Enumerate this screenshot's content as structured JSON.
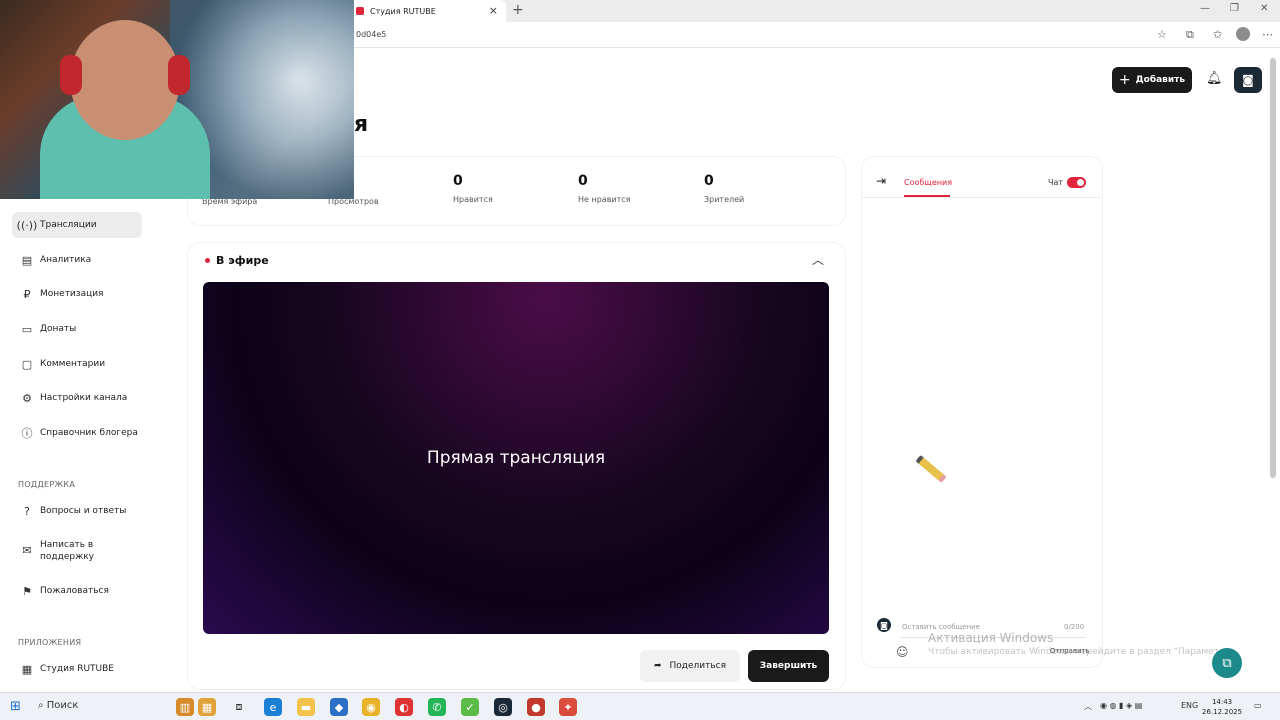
{
  "browser": {
    "tab_title": "Студия RUTUBE",
    "url_fragment": "0d04e5"
  },
  "header": {
    "add_label": "Добавить",
    "page_title_fragment": "я"
  },
  "sidebar": {
    "items": [
      {
        "label": "Трансляции",
        "icon": "broadcast-icon",
        "active": true
      },
      {
        "label": "Аналитика",
        "icon": "chart-icon"
      },
      {
        "label": "Монетизация",
        "icon": "ruble-icon"
      },
      {
        "label": "Донаты",
        "icon": "box-icon"
      },
      {
        "label": "Комментарии",
        "icon": "comment-icon"
      },
      {
        "label": "Настройки канала",
        "icon": "gear-icon"
      },
      {
        "label": "Справочник блогера",
        "icon": "info-icon"
      }
    ],
    "support_heading": "ПОДДЕРЖКА",
    "support_items": [
      {
        "label": "Вопросы и ответы",
        "icon": "question-icon"
      },
      {
        "label": "Написать в поддержку",
        "icon": "mail-icon"
      },
      {
        "label": "Пожаловаться",
        "icon": "flag-icon"
      }
    ],
    "apps_heading": "ПРИЛОЖЕНИЯ",
    "apps_items": [
      {
        "label": "Студия RUTUBE",
        "icon": "studio-icon"
      }
    ]
  },
  "stats": [
    {
      "value": "",
      "label": "Время эфира"
    },
    {
      "value": "",
      "label": "Просмотров"
    },
    {
      "value": "0",
      "label": "Нравится"
    },
    {
      "value": "0",
      "label": "Не нравится"
    },
    {
      "value": "0",
      "label": "Зрителей"
    }
  ],
  "live": {
    "heading": "В эфире",
    "player_label": "Прямая трансляция",
    "share_label": "Поделиться",
    "end_label": "Завершить"
  },
  "chat": {
    "tab_label": "Сообщения",
    "toggle_label": "Чат",
    "toggle_on": true,
    "input_placeholder": "Оставить сообщение",
    "char_count": "0/200",
    "send_label": "Отправить"
  },
  "system": {
    "watermark_title": "Активация Windows",
    "watermark_text": "Чтобы активировать Windows, перейдите в раздел \"Параметры\"",
    "search_label": "Поиск",
    "lang": "ENG",
    "time": "14:43",
    "date": "26.12.2025"
  },
  "colors": {
    "accent": "#e2233c",
    "dark_button": "#1a1a1a"
  }
}
